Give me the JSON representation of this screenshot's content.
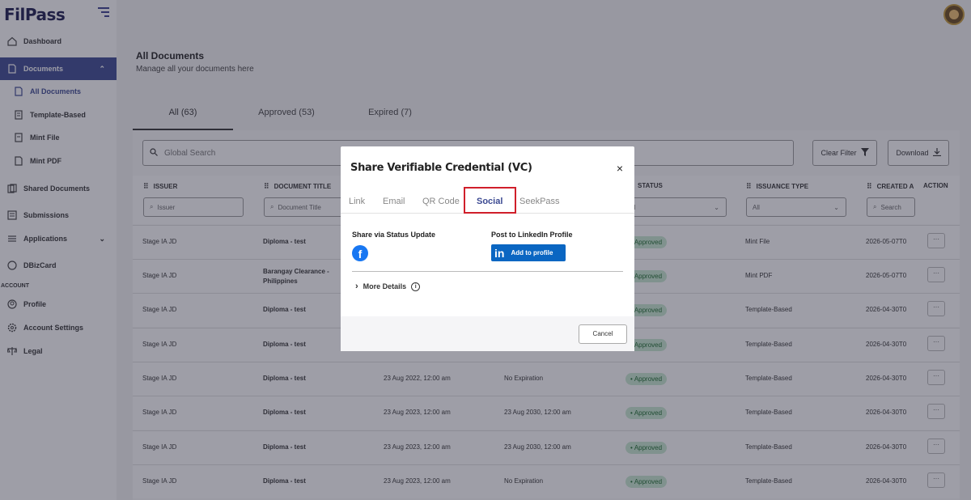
{
  "app": {
    "logo": "FilPass"
  },
  "sidebar": {
    "items": [
      {
        "label": "Dashboard"
      },
      {
        "label": "Documents"
      },
      {
        "label": "All Documents"
      },
      {
        "label": "Template-Based"
      },
      {
        "label": "Mint File"
      },
      {
        "label": "Mint PDF"
      },
      {
        "label": "Shared Documents"
      },
      {
        "label": "Submissions"
      },
      {
        "label": "Applications"
      },
      {
        "label": "DBizCard"
      }
    ],
    "section_account": "ACCOUNT",
    "account_items": [
      {
        "label": "Profile"
      },
      {
        "label": "Account Settings"
      },
      {
        "label": "Legal"
      }
    ]
  },
  "page": {
    "title": "All Documents",
    "subtitle": "Manage all your documents here"
  },
  "tabs": [
    {
      "label": "All (63)"
    },
    {
      "label": "Approved (53)"
    },
    {
      "label": "Expired (7)"
    }
  ],
  "toolbar": {
    "search_placeholder": "Global Search",
    "clear_filter": "Clear Filter",
    "download": "Download"
  },
  "table": {
    "headers": [
      "ISSUER",
      "DOCUMENT TITLE",
      "STATUS",
      "ISSUANCE TYPE",
      "CREATED A",
      "ACTION"
    ],
    "filters": {
      "issuer": "Issuer",
      "title": "Document Title",
      "status": "ll",
      "type": "All",
      "created": "Search"
    },
    "rows": [
      {
        "issuer": "Stage IA JD",
        "title": "Diploma - test",
        "issued": "",
        "expiry": "",
        "status": "Approved",
        "type": "Mint File",
        "created": "2026-05-07T0",
        "action": "···"
      },
      {
        "issuer": "Stage IA JD",
        "title": "Barangay Clearance - Philippines",
        "issued": "",
        "expiry": "",
        "status": "Approved",
        "type": "Mint PDF",
        "created": "2026-05-07T0",
        "action": "···"
      },
      {
        "issuer": "Stage IA JD",
        "title": "Diploma - test",
        "issued": "",
        "expiry": "",
        "status": "Approved",
        "type": "Template-Based",
        "created": "2026-04-30T0",
        "action": "···"
      },
      {
        "issuer": "Stage IA JD",
        "title": "Diploma - test",
        "issued": "",
        "expiry": "",
        "status": "Approved",
        "type": "Template-Based",
        "created": "2026-04-30T0",
        "action": "···"
      },
      {
        "issuer": "Stage IA JD",
        "title": "Diploma - test",
        "issued": "23 Aug 2022, 12:00 am",
        "expiry": "No Expiration",
        "status": "Approved",
        "type": "Template-Based",
        "created": "2026-04-30T0",
        "action": "···"
      },
      {
        "issuer": "Stage IA JD",
        "title": "Diploma - test",
        "issued": "23 Aug 2023, 12:00 am",
        "expiry": "23 Aug 2030, 12:00 am",
        "status": "Approved",
        "type": "Template-Based",
        "created": "2026-04-30T0",
        "action": "···"
      },
      {
        "issuer": "Stage IA JD",
        "title": "Diploma - test",
        "issued": "23 Aug 2023, 12:00 am",
        "expiry": "23 Aug 2030, 12:00 am",
        "status": "Approved",
        "type": "Template-Based",
        "created": "2026-04-30T0",
        "action": "···"
      },
      {
        "issuer": "Stage IA JD",
        "title": "Diploma - test",
        "issued": "23 Aug 2023, 12:00 am",
        "expiry": "No Expiration",
        "status": "Approved",
        "type": "Template-Based",
        "created": "2026-04-30T0",
        "action": "···"
      }
    ]
  },
  "modal": {
    "title": "Share Verifiable Credential (VC)",
    "close": "×",
    "tabs": [
      "Link",
      "Email",
      "QR Code",
      "Social",
      "SeekPass"
    ],
    "selected_tab": "Social",
    "share_status_label": "Share via Status Update",
    "linkedin_label": "Post to LinkedIn Profile",
    "linkedin_button": "Add to profile",
    "linkedin_logo": "in",
    "facebook_logo": "f",
    "more_details": "More Details",
    "cancel": "Cancel",
    "highlight_color": "#d01f2a"
  },
  "colors": {
    "brand": "#3c4a92",
    "approved_bg": "#c9ead2",
    "linkedin": "#0a66c2",
    "facebook": "#1877f2"
  }
}
